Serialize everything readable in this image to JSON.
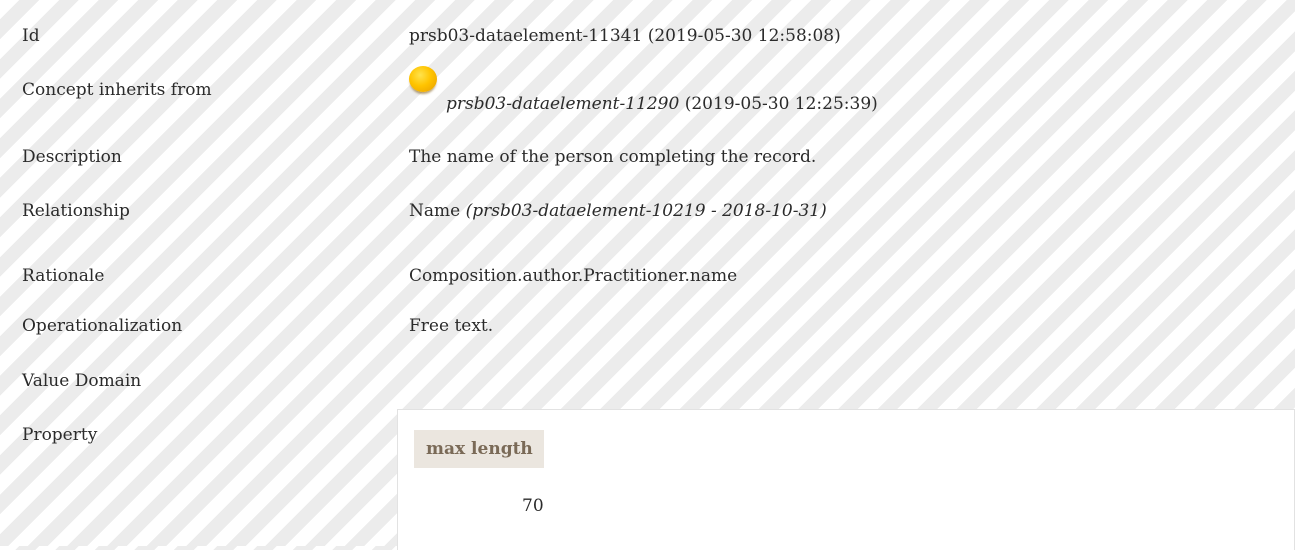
{
  "rows": {
    "id": {
      "label": "Id",
      "value": "prsb03-dataelement-11341 (2019-05-30 12:58:08)"
    },
    "inherits": {
      "label": "Concept inherits from",
      "ref": "prsb03-dataelement-11290",
      "date": "(2019-05-30 12:25:39)",
      "status_icon": "status-dot-yellow-icon",
      "status_color": "#ffc400"
    },
    "description": {
      "label": "Description",
      "value": "The name of the person completing the record."
    },
    "relationship": {
      "label": "Relationship",
      "value": "Name",
      "ref": "(prsb03-dataelement-10219 - 2018-10-31)"
    },
    "rationale": {
      "label": "Rationale",
      "value": "Composition.author.Practitioner.name"
    },
    "operationalization": {
      "label": "Operationalization",
      "value": "Free text."
    },
    "value_domain": {
      "label": "Value Domain"
    },
    "property": {
      "label": "Property",
      "header": "max length",
      "value": "70"
    }
  },
  "colors": {
    "text": "#2b2b2b",
    "stripe": "#ececec",
    "header_bg": "#ebe6df",
    "header_text": "#7a6a57"
  }
}
